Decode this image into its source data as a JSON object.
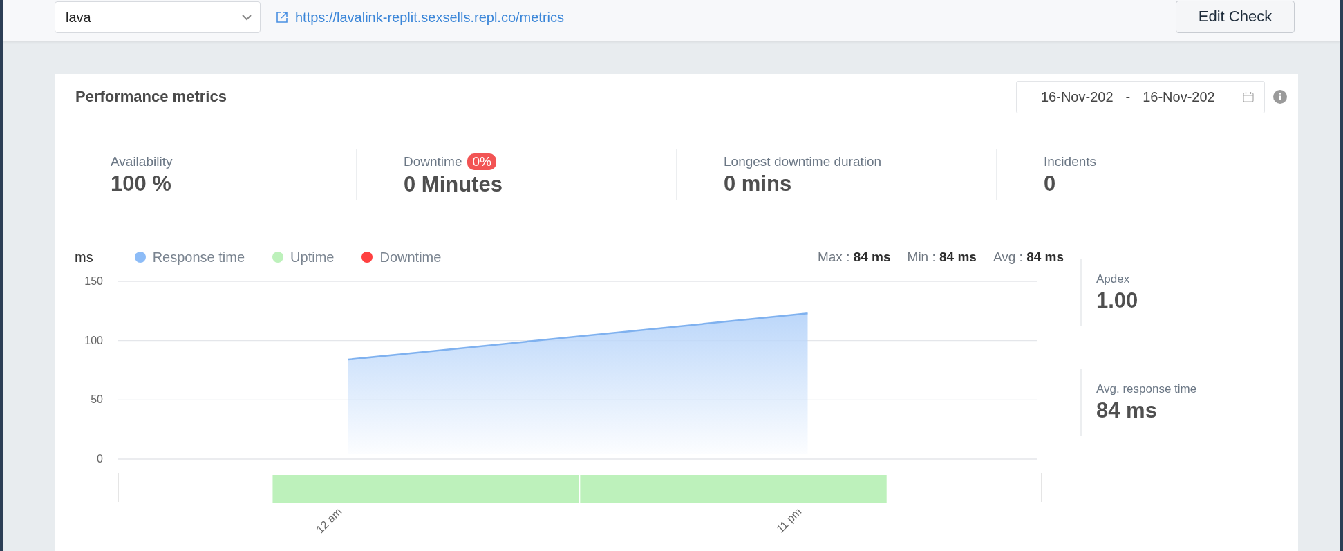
{
  "toolbar": {
    "monitor_select": {
      "value": "lava"
    },
    "url": "https://lavalink-replit.sexsells.repl.co/metrics",
    "edit_button": "Edit Check"
  },
  "panel": {
    "title": "Performance metrics",
    "date_range": {
      "from": "16-Nov-202",
      "separator": "-",
      "to": "16-Nov-202"
    },
    "metrics": [
      {
        "label": "Availability",
        "value": "100 %"
      },
      {
        "label": "Downtime",
        "badge": "0%",
        "value": "0 Minutes"
      },
      {
        "label": "Longest downtime duration",
        "value": "0 mins"
      },
      {
        "label": "Incidents",
        "value": "0"
      }
    ],
    "chart": {
      "unit": "ms",
      "legend": [
        {
          "label": "Uptime",
          "color": "#bdf1bb"
        },
        {
          "label": "Downtime",
          "color": "#ff4040"
        }
      ],
      "stats": [
        {
          "label": "Max :",
          "value": "84 ms"
        },
        {
          "label": "Min :",
          "value": "84 ms"
        },
        {
          "label": "Avg :",
          "value": "84 ms"
        }
      ],
      "chart_data": {
        "type": "area",
        "categories": [
          "12 am",
          "11 pm"
        ],
        "ylim": [
          0,
          150
        ],
        "yticks": [
          0,
          50,
          100,
          150
        ],
        "series": [
          {
            "name": "Response time",
            "color": "#7fb1ef",
            "values": [
              84,
              123
            ]
          }
        ]
      },
      "timeline": [
        {
          "kind": "uptime"
        },
        {
          "kind": "uptime"
        }
      ]
    },
    "summary": [
      {
        "label": "Apdex",
        "value": "1.00"
      },
      {
        "label": "Avg. response time",
        "value": "84 ms"
      }
    ]
  }
}
